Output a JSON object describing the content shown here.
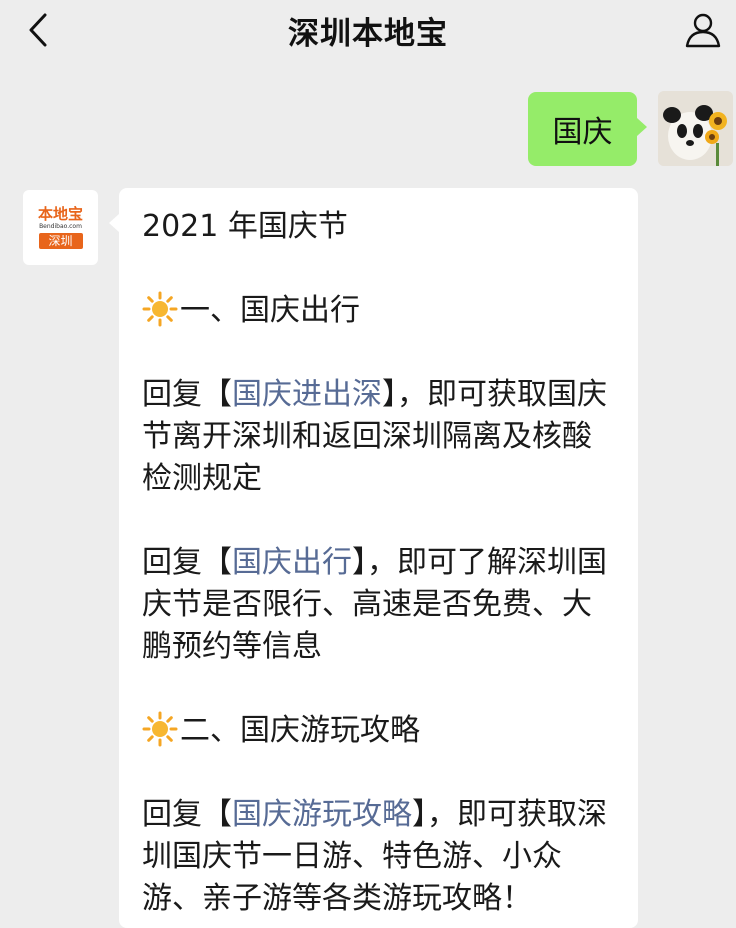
{
  "header": {
    "title": "深圳本地宝",
    "back_icon": "chevron-left-icon",
    "profile_icon": "person-icon"
  },
  "messages": {
    "outgoing": {
      "text": "国庆"
    },
    "incoming": {
      "avatar": {
        "logo_text": "本地宝",
        "url_text": "Bendibao.com",
        "city_text": "深圳"
      },
      "line1": "2021 年国庆节",
      "section1_title": "一、国庆出行",
      "p1_prefix": "回复【",
      "p1_link": "国庆进出深",
      "p1_suffix": "】，即可获取国庆节离开深圳和返回深圳隔离及核酸检测规定",
      "p2_prefix": "回复【",
      "p2_link": "国庆出行",
      "p2_suffix": "】，即可了解深圳国庆节是否限行、高速是否免费、大鹏预约等信息",
      "section2_title": "二、国庆游玩攻略",
      "p3_prefix": "回复【",
      "p3_link": "国庆游玩攻略",
      "p3_suffix": "】，即可获取深圳国庆节一日游、特色游、小众游、亲子游等各类游玩攻略！"
    }
  },
  "colors": {
    "background": "#ededed",
    "outgoing_bubble": "#95ec69",
    "incoming_bubble": "#ffffff",
    "link": "#576b95",
    "logo_orange": "#e8651b"
  }
}
